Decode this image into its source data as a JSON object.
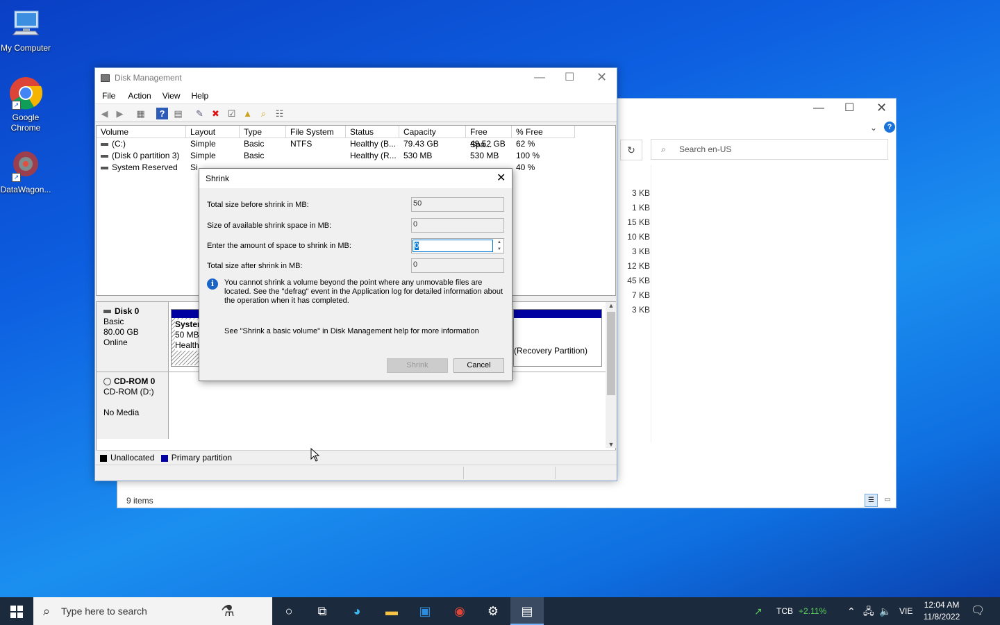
{
  "desktop": {
    "icons": [
      {
        "label": "My Computer"
      },
      {
        "label": "Google Chrome"
      },
      {
        "label": "DataWagon..."
      }
    ]
  },
  "explorer": {
    "search_placeholder": "Search en-US",
    "sizes": [
      "3 KB",
      "1 KB",
      "15 KB",
      "10 KB",
      "3 KB",
      "12 KB",
      "45 KB",
      "7 KB",
      "3 KB"
    ],
    "status": "9 items"
  },
  "disk_management": {
    "title": "Disk Management",
    "menu": [
      "File",
      "Action",
      "View",
      "Help"
    ],
    "columns": [
      "Volume",
      "Layout",
      "Type",
      "File System",
      "Status",
      "Capacity",
      "Free Spa...",
      "% Free"
    ],
    "volumes": [
      {
        "volume": "(C:)",
        "layout": "Simple",
        "type": "Basic",
        "fs": "NTFS",
        "status": "Healthy (B...",
        "capacity": "79.43 GB",
        "free": "49.52 GB",
        "pct": "62 %"
      },
      {
        "volume": "(Disk 0 partition 3)",
        "layout": "Simple",
        "type": "Basic",
        "fs": "",
        "status": "Healthy (R...",
        "capacity": "530 MB",
        "free": "530 MB",
        "pct": "100 %"
      },
      {
        "volume": "System Reserved",
        "layout": "Si",
        "type": "",
        "fs": "",
        "status": "",
        "capacity": "",
        "free": "",
        "pct": "40 %"
      }
    ],
    "disk0": {
      "name": "Disk 0",
      "type": "Basic",
      "size": "80.00 GB",
      "state": "Online"
    },
    "disk0_partition_sys": {
      "name": "Systen",
      "size": "50 MB",
      "status": "Health"
    },
    "disk0_partition_recovery": "(Recovery Partition)",
    "cdrom": {
      "name": "CD-ROM 0",
      "drive": "CD-ROM (D:)",
      "media": "No Media"
    },
    "legend": {
      "unallocated": "Unallocated",
      "primary": "Primary partition"
    },
    "colors": {
      "primary": "#0000a0",
      "unallocated": "#000000"
    }
  },
  "shrink_dialog": {
    "title": "Shrink",
    "total_before_label": "Total size before shrink in MB:",
    "total_before_value": "50",
    "available_label": "Size of available shrink space in MB:",
    "available_value": "0",
    "amount_label": "Enter the amount of space to shrink in MB:",
    "amount_value": "0",
    "total_after_label": "Total size after shrink in MB:",
    "total_after_value": "0",
    "info_text": "You cannot shrink a volume beyond the point where any unmovable files are located. See the \"defrag\" event in the Application log for detailed information about the operation when it has completed.",
    "help_text": "See \"Shrink a basic volume\" in Disk Management help for more information",
    "shrink_button": "Shrink",
    "cancel_button": "Cancel"
  },
  "taskbar": {
    "search_placeholder": "Type here to search",
    "stock_name": "TCB",
    "stock_change": "+2.11%",
    "language": "VIE",
    "time": "12:04 AM",
    "date": "11/8/2022"
  }
}
